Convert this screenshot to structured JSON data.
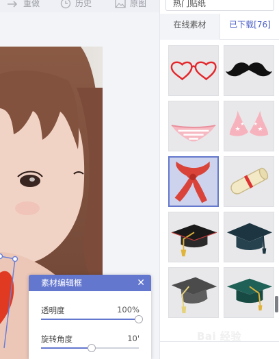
{
  "toolbar": {
    "redo_label": "重做",
    "history_label": "历史",
    "original_label": "原图"
  },
  "panel": {
    "dropdown_label": "热门贴纸",
    "tabs": [
      {
        "label": "在线素材"
      },
      {
        "label": "已下载[76]"
      }
    ],
    "stickers": [
      {
        "name": "heart-glasses"
      },
      {
        "name": "mustache"
      },
      {
        "name": "striped-bikini-bottom"
      },
      {
        "name": "star-bikini-top"
      },
      {
        "name": "red-scarf"
      },
      {
        "name": "diploma-scroll"
      },
      {
        "name": "graduation-cap-black"
      },
      {
        "name": "graduation-cap-teal"
      },
      {
        "name": "graduation-cap-grey"
      },
      {
        "name": "graduation-cap-green"
      }
    ]
  },
  "dialog": {
    "title": "素材编辑框",
    "close_label": "✕",
    "opacity_label": "透明度",
    "opacity_value": "100%",
    "opacity_fraction": 1.0,
    "rotation_label": "旋转角度",
    "rotation_value": "10'",
    "rotation_fraction": 0.52
  },
  "watermark": "Bai 经验",
  "colors": {
    "accent": "#6477cf",
    "tab_active_text": "#4f63c8",
    "selection_border": "#6478cc"
  }
}
